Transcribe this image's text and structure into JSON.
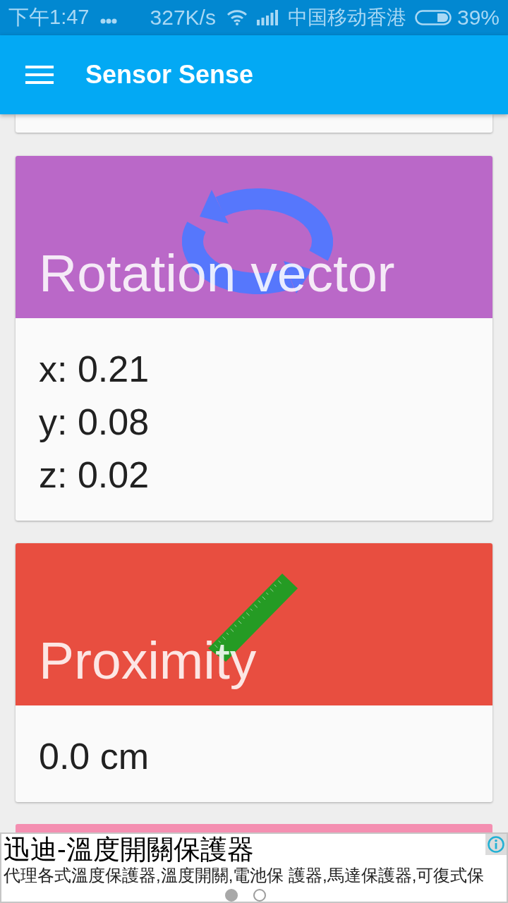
{
  "status_bar": {
    "time": "下午1:47",
    "speed": "327K/s",
    "carrier": "中国移动香港",
    "battery": "39%"
  },
  "app_bar": {
    "title": "Sensor Sense"
  },
  "cards": [
    {
      "kind": "rotation",
      "title": "Rotation vector",
      "color": "#ba68c8",
      "values": [
        "x: 0.21",
        "y: 0.08",
        "z: 0.02"
      ]
    },
    {
      "kind": "ruler",
      "title": "Proximity",
      "color": "#e84e40",
      "values": [
        "0.0 cm"
      ]
    }
  ],
  "next_card": {
    "color": "#f48fb1"
  },
  "ad": {
    "title": "迅迪-溫度開關保護器",
    "text": "代理各式溫度保護器,溫度開關,電池保 護器,馬達保護器,可復式保",
    "pages": [
      {
        "selected": true
      },
      {
        "selected": false
      }
    ]
  }
}
